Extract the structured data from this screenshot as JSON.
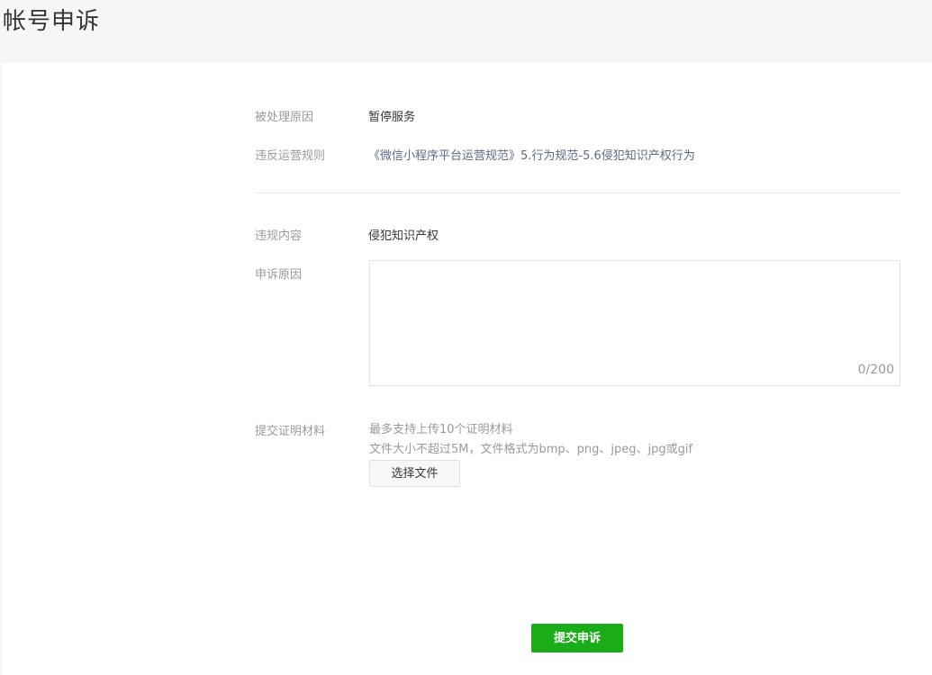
{
  "header": {
    "title": "帐号申诉"
  },
  "violation": {
    "reason_label": "被处理原因",
    "reason_value": "暂停服务",
    "rule_label": "违反运营规则",
    "rule_value": "《微信小程序平台运营规范》5.行为规范-5.6侵犯知识产权行为"
  },
  "appeal": {
    "content_label": "违规内容",
    "content_value": "侵犯知识产权",
    "reason_label": "申诉原因",
    "reason_value": "",
    "reason_counter": "0/200"
  },
  "evidence": {
    "label": "提交证明材料",
    "hint_count": "最多支持上传10个证明材料",
    "hint_format": "文件大小不超过5M，文件格式为bmp、png、jpeg、jpg或gif",
    "choose_file_label": "选择文件"
  },
  "actions": {
    "submit_label": "提交申诉",
    "submit_color": "#1aad19"
  }
}
